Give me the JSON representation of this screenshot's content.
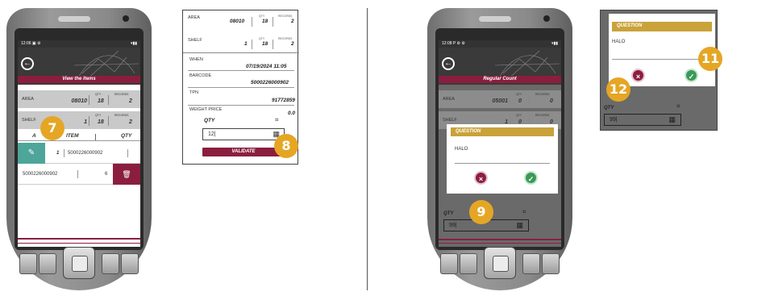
{
  "device1": {
    "status_time": "12:06",
    "banner": "View the Items",
    "area": {
      "label": "AREA",
      "value": "08010",
      "qty_label": "QTY",
      "qty_value": "18",
      "records_label": "RECORDS",
      "records_value": "2"
    },
    "shelf": {
      "label": "SHELF",
      "value": "1",
      "qty_label": "QTY",
      "qty_value": "18",
      "records_label": "RECORDS",
      "records_value": "2"
    },
    "table": {
      "col_a": "A",
      "col_item": "ITEM",
      "col_qty": "QTY"
    },
    "rows": [
      {
        "qty": "1",
        "item": "5000226000902"
      },
      {
        "item": "5000226000902",
        "qty": "6"
      }
    ],
    "badge": "7"
  },
  "panel": {
    "area": {
      "label": "AREA",
      "value": "08010",
      "qty_label": "QTY",
      "qty_value": "18",
      "records_label": "RECORDS",
      "records_value": "2"
    },
    "shelf": {
      "label": "SHELF",
      "value": "1",
      "qty_label": "QTY",
      "qty_value": "18",
      "records_label": "RECORDS",
      "records_value": "2"
    },
    "when_label": "WHEN",
    "when_value": "07/19/2024 11:05",
    "barcode_label": "BARCODE",
    "barcode_value": "5000226000902",
    "tpn_label": "TPN",
    "tpn_value": "91772859",
    "weight_label": "WEIGHT PRICE",
    "weight_value": "0.0",
    "qty_label": "QTY",
    "qty_input": "12",
    "validate_label": "VALIDATE",
    "badge": "8"
  },
  "device2": {
    "status_time": "12:08",
    "banner": "Regular Count",
    "area": {
      "label": "AREA",
      "value": "05001",
      "qty_label": "QTY",
      "qty_value": "0",
      "records_label": "RECORDS",
      "records_value": "0"
    },
    "shelf": {
      "label": "SHELF",
      "value": "1",
      "qty_label": "QTY",
      "qty_value": "0",
      "records_label": "RECORDS",
      "records_value": "0"
    },
    "dialog_title": "QUESTION",
    "dialog_text": "HALO",
    "qty_label": "QTY",
    "qty_input": "99",
    "badge": "9"
  },
  "zoom": {
    "dialog_title": "QUESTION",
    "dialog_text": "HALO",
    "qty_label": "QTY",
    "qty_input": "99",
    "badge_confirm": "11",
    "badge_cancel": "12"
  },
  "colors": {
    "brand": "#8b1e3f",
    "teal": "#4ea59a",
    "gold": "#c9a23a",
    "badge": "#e5a625"
  }
}
